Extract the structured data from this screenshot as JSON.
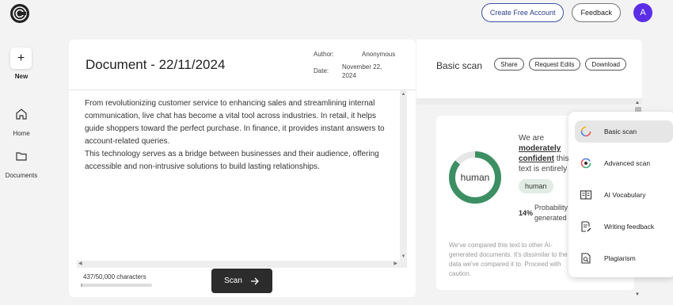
{
  "header": {
    "create_account_label": "Create Free Account",
    "feedback_label": "Feedback",
    "avatar_initial": "A"
  },
  "sidebar": {
    "new_label": "New",
    "items": [
      {
        "label": "Home",
        "icon": "home-icon"
      },
      {
        "label": "Documents",
        "icon": "folder-icon"
      }
    ]
  },
  "document": {
    "title": "Document - 22/11/2024",
    "author_label": "Author:",
    "author_value": "Anonymous",
    "date_label": "Date:",
    "date_value_line1": "November 22,",
    "date_value_line2": "2024",
    "paragraphs": [
      "From revolutionizing customer service to enhancing sales and streamlining internal communication, live chat has become a vital tool across industries. In retail, it helps guide shoppers toward the perfect purchase. In finance, it provides instant answers to account-related queries.",
      "This technology serves as a bridge between businesses and their audience, offering accessible and non-intrusive solutions to build lasting relationships."
    ],
    "char_count": "437/50,000 characters",
    "char_fraction": 0.0087,
    "scan_label": "Scan"
  },
  "results": {
    "title": "Basic scan",
    "share_label": "Share",
    "request_edits_label": "Request Edits",
    "download_label": "Download",
    "donut_label": "human",
    "msg_pre": "We are",
    "msg_confidence_1": "moderately",
    "msg_confidence_2": "confident",
    "msg_mid": "this",
    "msg_end": "text is entirely",
    "tag_label": "human",
    "probability_pct": "14%",
    "probability_line1": "Probability",
    "probability_line2": "generated",
    "note": "We've compared this text to other AI-generated documents. It's dissimilar to the data we've compared it to. Proceed with caution."
  },
  "menu": {
    "items": [
      {
        "label": "Basic scan",
        "icon": "basic-scan-icon",
        "active": true
      },
      {
        "label": "Advanced scan",
        "icon": "advanced-scan-icon",
        "active": false
      },
      {
        "label": "AI Vocabulary",
        "icon": "ai-vocabulary-icon",
        "active": false
      },
      {
        "label": "Writing feedback",
        "icon": "writing-feedback-icon",
        "active": false
      },
      {
        "label": "Plagiarism",
        "icon": "plagiarism-icon",
        "active": false
      }
    ]
  },
  "colors": {
    "accent_blue": "#2a3f8f",
    "avatar_purple": "#5b2ee6",
    "human_green": "#3d8f63",
    "dark_button": "#2c2c2c"
  }
}
